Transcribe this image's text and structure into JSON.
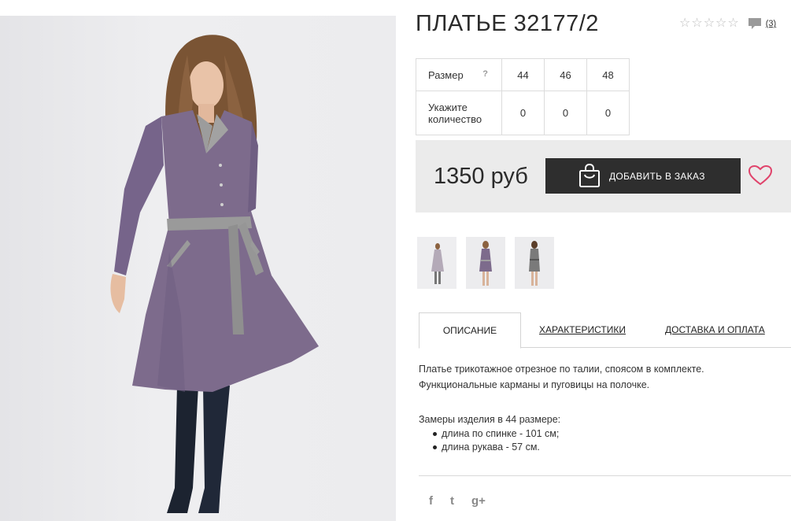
{
  "product": {
    "title": "ПЛАТЬЕ 32177/2",
    "reviews_count": "(3)",
    "rating_stars": 0
  },
  "sizes": {
    "size_label": "Размер",
    "help_mark": "?",
    "qty_label": "Укажите количество",
    "options": [
      {
        "size": "44",
        "qty": "0"
      },
      {
        "size": "46",
        "qty": "0"
      },
      {
        "size": "48",
        "qty": "0"
      }
    ]
  },
  "purchase": {
    "price": "1350 руб",
    "add_button_label": "ДОБАВИТЬ В ЗАКАЗ"
  },
  "tabs": [
    {
      "label": "ОПИСАНИЕ",
      "active": true
    },
    {
      "label": "ХАРАКТЕРИСТИКИ",
      "active": false
    },
    {
      "label": "ДОСТАВКА И ОПЛАТА",
      "active": false
    }
  ],
  "description": {
    "line1": "Платье трикотажное отрезное по талии, спояcом в комплекте.",
    "line2": "Функциональные карманы и пуговицы на полочке.",
    "measurements_title": "Замеры изделия в 44 размере:",
    "measurements": [
      "длина по спинке - 101 см;",
      "длина рукава - 57 см."
    ]
  },
  "social": {
    "facebook": "f",
    "twitter": "t",
    "googleplus": "g+"
  },
  "icons": {
    "star": "star-outline-icon",
    "comment": "comment-icon",
    "bag": "shopping-bag-icon",
    "heart": "heart-icon"
  },
  "colors": {
    "dress": "#7d6b8c",
    "button": "#2e2e2e",
    "heart": "#e0436b",
    "price_box": "#ebebeb"
  }
}
